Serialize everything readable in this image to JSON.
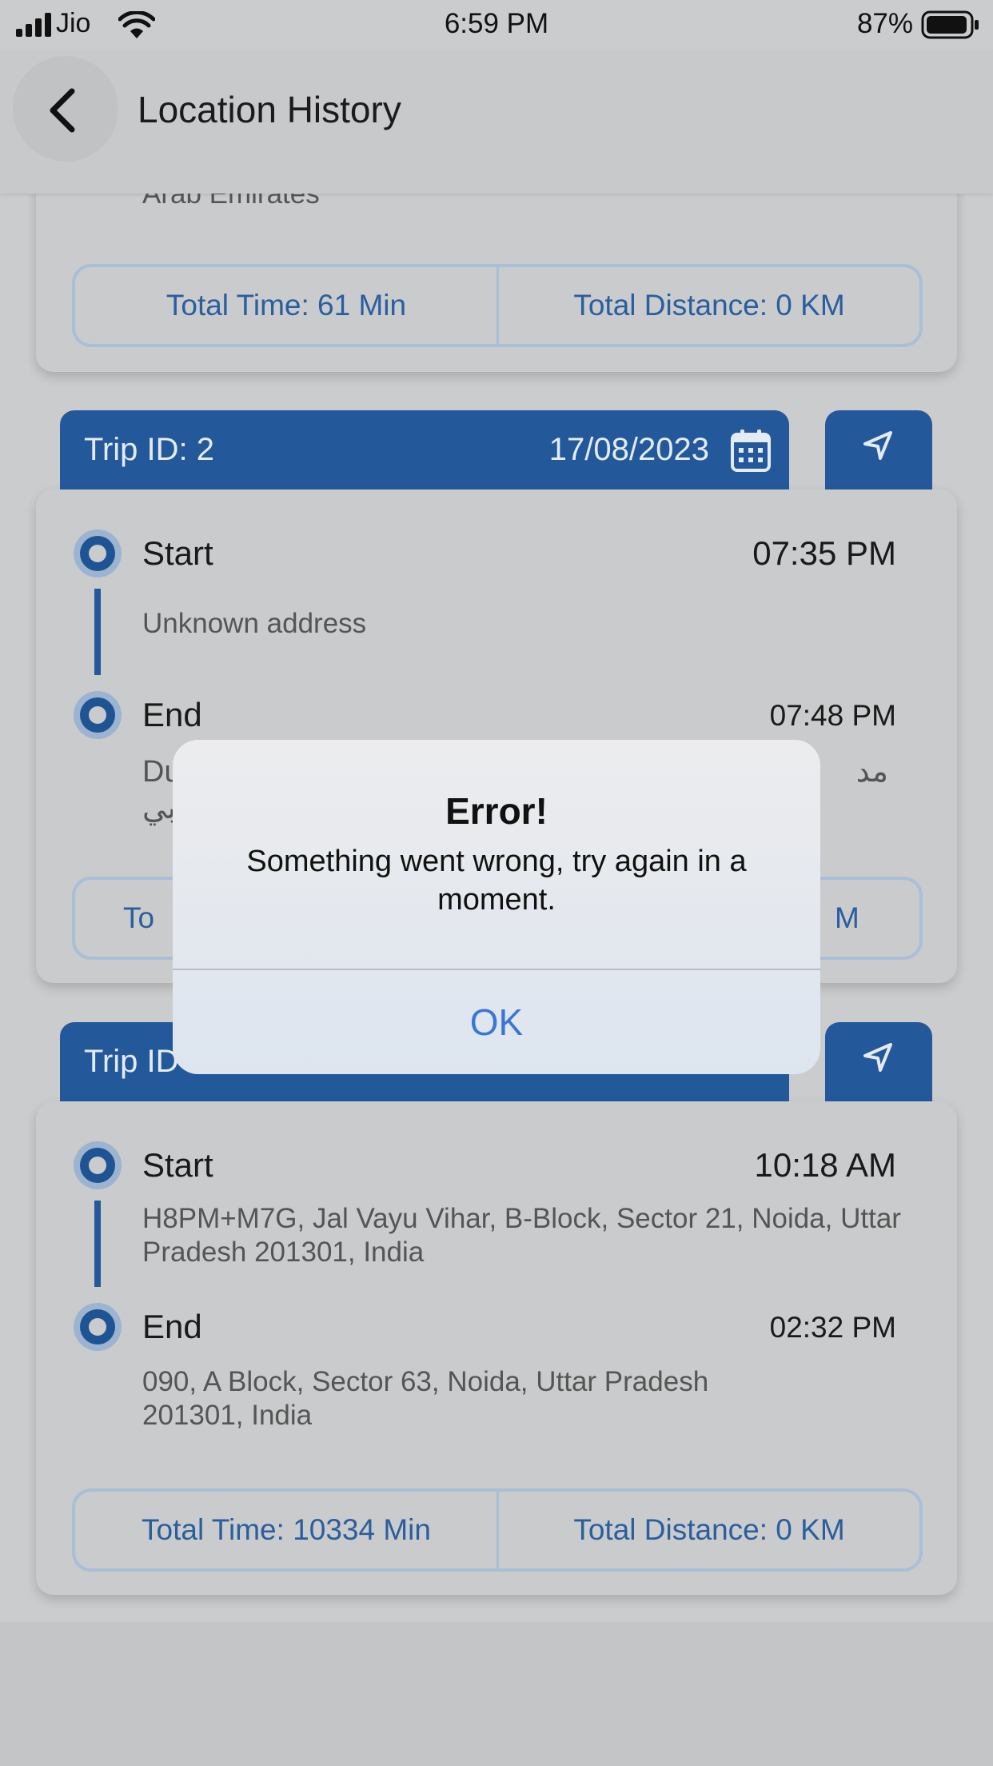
{
  "status_bar": {
    "carrier": "Jio",
    "time": "6:59 PM",
    "battery": "87%"
  },
  "header": {
    "title": "Location History"
  },
  "trip_top_partial": {
    "address_tail": "Arab Emirates",
    "total_time": "Total Time: 61 Min",
    "total_distance": "Total Distance: 0 KM"
  },
  "trip_2": {
    "id": "Trip ID: 2",
    "date": "17/08/2023",
    "start_label": "Start",
    "start_time": "07:35 PM",
    "start_address": "Unknown address",
    "end_label": "End",
    "end_time": "07:48 PM",
    "end_address_left_1": "Du",
    "end_address_left_2": "بي",
    "end_address_right": "مد",
    "total_time_fragment": "To",
    "total_distance_fragment": "M"
  },
  "trip_3": {
    "id_fragment": "Trip ID",
    "start_label": "Start",
    "start_time": "10:18 AM",
    "start_address": "H8PM+M7G, Jal Vayu Vihar, B-Block, Sector 21, Noida, Uttar Pradesh 201301, India",
    "end_label": "End",
    "end_time": "02:32 PM",
    "end_address": "090, A Block, Sector 63, Noida, Uttar Pradesh 201301, India",
    "total_time": "Total Time: 10334 Min",
    "total_distance": "Total Distance: 0 KM"
  },
  "alert": {
    "title": "Error!",
    "message": "Something went wrong, try again in a moment.",
    "ok_label": "OK"
  },
  "icons": {
    "back": "chevron-left-icon",
    "calendar": "calendar-icon",
    "navigate": "navigation-arrow-icon"
  },
  "colors": {
    "accent": "#23599b",
    "link": "#3a76d6"
  }
}
